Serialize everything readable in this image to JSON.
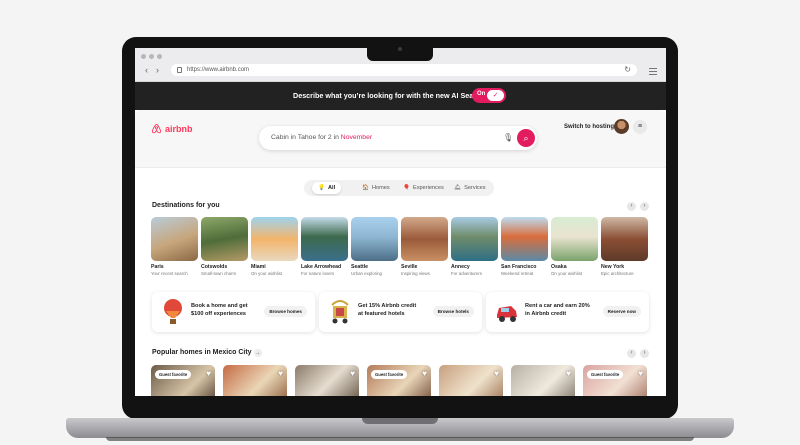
{
  "browser": {
    "url": "https://www.airbnb.com"
  },
  "banner": {
    "text": "Describe what you’re looking for with the new AI Search",
    "toggle_label": "On"
  },
  "header": {
    "logo_text": "airbnb",
    "search_text": "Cabin in Tahoe for 2 in ",
    "search_highlight": "November",
    "host_link": "Switch to hosting"
  },
  "tabs": [
    {
      "label": "All",
      "icon": "all-icon",
      "active": true
    },
    {
      "label": "Homes",
      "icon": "home-icon",
      "active": false
    },
    {
      "label": "Experiences",
      "icon": "balloon-icon",
      "active": false
    },
    {
      "label": "Services",
      "icon": "bell-icon",
      "active": false
    }
  ],
  "destinations": {
    "title": "Destinations for you",
    "items": [
      {
        "name": "Paris",
        "sub": "Your recent search"
      },
      {
        "name": "Cotswolds",
        "sub": "Small-town charm"
      },
      {
        "name": "Miami",
        "sub": "On your wishlist"
      },
      {
        "name": "Lake Arrowhead",
        "sub": "For nature lovers"
      },
      {
        "name": "Seattle",
        "sub": "Urban exploring"
      },
      {
        "name": "Seville",
        "sub": "Inspiring views"
      },
      {
        "name": "Annecy",
        "sub": "For adventurers"
      },
      {
        "name": "San Francisco",
        "sub": "Weekend retreat"
      },
      {
        "name": "Osaka",
        "sub": "On your wishlist"
      },
      {
        "name": "New York",
        "sub": "Epic architecture"
      }
    ]
  },
  "promos": [
    {
      "line1": "Book a home and get",
      "line2": "$100 off experiences",
      "button": "Browse homes",
      "icon": "hot-air-balloon-icon"
    },
    {
      "line1": "Get 15% Airbnb credit",
      "line2": "at featured hotels",
      "button": "Browse hotels",
      "icon": "bellhop-cart-icon"
    },
    {
      "line1": "Rent a car and earn 20%",
      "line2": "in Airbnb credit",
      "button": "Reserve now",
      "icon": "red-car-icon"
    }
  ],
  "popular": {
    "title": "Popular homes in Mexico City",
    "badge": "Guest favorite"
  }
}
